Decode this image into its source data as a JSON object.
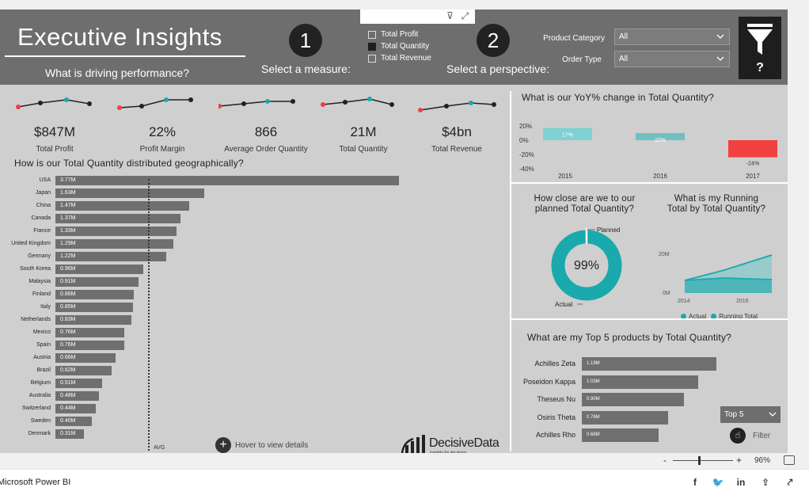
{
  "header": {
    "title": "Executive Insights",
    "subtitle": "What is driving performance?",
    "step1": {
      "number": "1",
      "label": "Select a measure:"
    },
    "step2": {
      "number": "2",
      "label": "Select a perspective:"
    },
    "measures": [
      {
        "label": "Total Profit",
        "checked": false
      },
      {
        "label": "Total Quantity",
        "checked": true
      },
      {
        "label": "Total Revenue",
        "checked": false
      }
    ],
    "slicers": [
      {
        "label": "Product Category",
        "value": "All"
      },
      {
        "label": "Order Type",
        "value": "All"
      }
    ],
    "filter_help": "?"
  },
  "kpis": [
    {
      "value": "$847M",
      "label": "Total Profit"
    },
    {
      "value": "22%",
      "label": "Profit Margin"
    },
    {
      "value": "866",
      "label": "Average Order Quantity"
    },
    {
      "value": "21M",
      "label": "Total Quantity"
    },
    {
      "value": "$4bn",
      "label": "Total Revenue"
    }
  ],
  "geo": {
    "title": "How is our Total Quantity distributed geographically?",
    "avg_label": "AVG",
    "hover_hint": "Hover to view details"
  },
  "yoy": {
    "title": "What is our YoY% change in Total Quantity?"
  },
  "planned": {
    "title_line1": "How close are we to our",
    "title_line2": "planned Total Quantity?",
    "percent": "99%",
    "planned_label": "Planned",
    "actual_label": "Actual"
  },
  "running": {
    "title_line1": "What is my Running",
    "title_line2": "Total by Total Quantity?",
    "legend": [
      "Actual",
      "Running Total"
    ]
  },
  "top5": {
    "title": "What are my Top 5 products by Total Quantity?",
    "select_value": "Top 5",
    "filter_label": "Filter"
  },
  "logo": {
    "name": "DecisiveData",
    "tagline": "insights for decisions"
  },
  "zoom": {
    "minus": "-",
    "plus": "+",
    "percent": "96%"
  },
  "footer": {
    "brand": "Microsoft Power BI"
  },
  "colors": {
    "header": "#6e6e6e",
    "teal": "#1aa9ad",
    "teal_light": "#7fd1d3",
    "negative": "#f04040",
    "bar": "#6f6f6f"
  },
  "chart_data": [
    {
      "type": "bar",
      "orientation": "horizontal",
      "title": "How is our Total Quantity distributed geographically?",
      "categories": [
        "USA",
        "Japan",
        "China",
        "Canada",
        "France",
        "United Kingdom",
        "Germany",
        "South Korea",
        "Malaysia",
        "Finland",
        "Italy",
        "Netherlands",
        "Mexico",
        "Spain",
        "Austria",
        "Brazil",
        "Belgium",
        "Australia",
        "Switzerland",
        "Sweden",
        "Denmark"
      ],
      "values": [
        3.77,
        1.63,
        1.47,
        1.37,
        1.33,
        1.29,
        1.22,
        0.96,
        0.91,
        0.86,
        0.85,
        0.83,
        0.76,
        0.76,
        0.66,
        0.62,
        0.51,
        0.48,
        0.44,
        0.4,
        0.31
      ],
      "labels": [
        "3.77M",
        "1.63M",
        "1.47M",
        "1.37M",
        "1.33M",
        "1.29M",
        "1.22M",
        "0.96M",
        "0.91M",
        "0.86M",
        "0.85M",
        "0.83M",
        "0.76M",
        "0.76M",
        "0.66M",
        "0.62M",
        "0.51M",
        "0.48M",
        "0.44M",
        "0.40M",
        "0.31M"
      ],
      "reference_line": "AVG"
    },
    {
      "type": "bar",
      "title": "What is our YoY% change in Total Quantity?",
      "categories": [
        "2015",
        "2016",
        "2017"
      ],
      "values": [
        17,
        10,
        -24
      ],
      "labels": [
        "17%",
        "10%",
        "-24%"
      ],
      "y_ticks": [
        "20%",
        "0%",
        "-20%",
        "-40%"
      ],
      "ylim": [
        -40,
        20
      ]
    },
    {
      "type": "pie",
      "title": "How close are we to our planned Total Quantity?",
      "center_label": "99%",
      "slices": [
        {
          "name": "Actual",
          "value": 99
        },
        {
          "name": "Planned",
          "value": 1
        }
      ]
    },
    {
      "type": "area",
      "title": "What is my Running Total by Total Quantity?",
      "x": [
        "2014",
        "2016"
      ],
      "y_ticks": [
        "20M",
        "0M"
      ],
      "series": [
        {
          "name": "Actual",
          "values": [
            5,
            6.5,
            5.5
          ]
        },
        {
          "name": "Running Total",
          "values": [
            5,
            11.5,
            21
          ]
        }
      ],
      "ylim": [
        0,
        25
      ]
    },
    {
      "type": "bar",
      "orientation": "horizontal",
      "title": "What are my Top 5 products by Total Quantity?",
      "categories": [
        "Achilles Zeta",
        "Poseidon Kappa",
        "Theseus Nu",
        "Osiris Theta",
        "Achilles Rho"
      ],
      "values": [
        1.19,
        1.03,
        0.9,
        0.76,
        0.68
      ],
      "labels": [
        "1.19M",
        "1.03M",
        "0.90M",
        "0.76M",
        "0.68M"
      ]
    }
  ]
}
